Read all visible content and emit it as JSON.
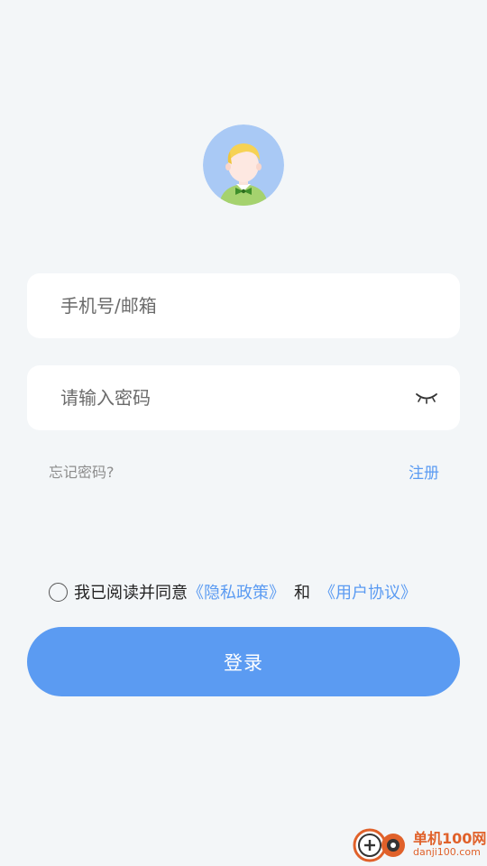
{
  "avatar": {
    "icon": "user-avatar-icon"
  },
  "login_form": {
    "phone_placeholder": "手机号/邮箱",
    "password_placeholder": "请输入密码",
    "toggle_visibility_icon": "eye-closed-icon"
  },
  "links": {
    "forgot_password": "忘记密码?",
    "register": "注册"
  },
  "agreement": {
    "prefix": "我已阅读并同意",
    "privacy_policy": "《隐私政策》",
    "conjunction": "和",
    "user_agreement": "《用户协议》",
    "checked": false
  },
  "login_button": {
    "label": "登录"
  },
  "watermark": {
    "name": "单机100网",
    "url": "danji100.com"
  },
  "colors": {
    "background": "#f3f6f8",
    "accent": "#5b9bf2",
    "field_bg": "#ffffff",
    "watermark": "#e0612a"
  }
}
